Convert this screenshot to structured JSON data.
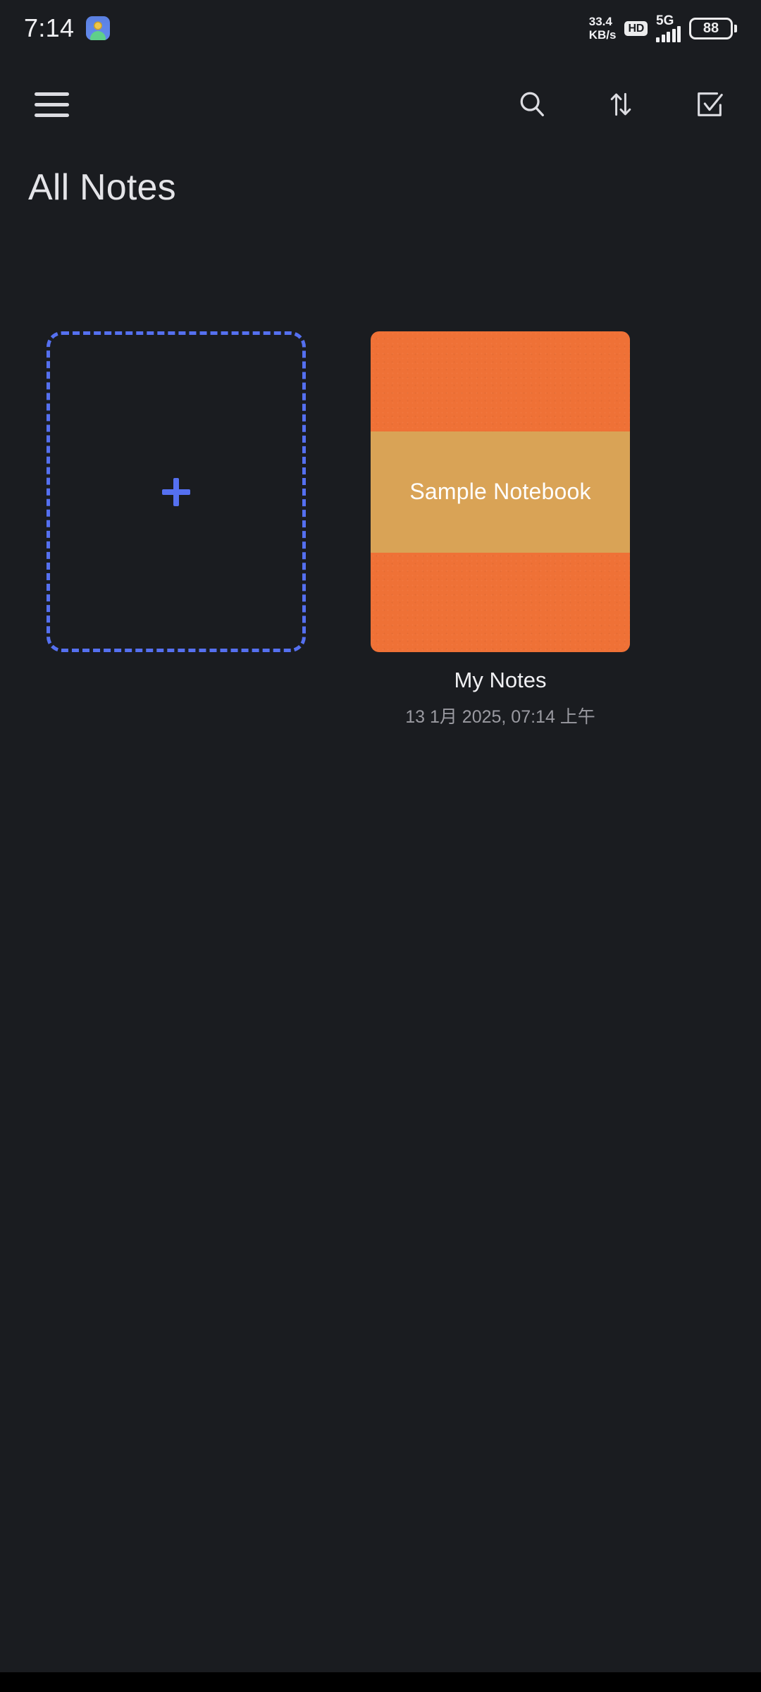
{
  "status_bar": {
    "clock": "7:14",
    "app_icon": "android-app-icon",
    "net_speed_value": "33.4",
    "net_speed_unit": "KB/s",
    "hd_badge": "HD",
    "network_generation": "5G",
    "signal_bars": 5,
    "battery_level": "88"
  },
  "toolbar": {
    "menu_icon": "hamburger-menu-icon",
    "search_icon": "search-icon",
    "sort_icon": "sort-arrows-icon",
    "select_icon": "checkbox-select-icon"
  },
  "header": {
    "title": "All Notes"
  },
  "grid": {
    "add_card": {
      "icon": "plus-icon",
      "accent_color": "#5570f0"
    },
    "notebooks": [
      {
        "cover_title": "Sample Notebook",
        "name": "My Notes",
        "date": "13 1月 2025, 07:14 上午",
        "cover_color": "#ef7136",
        "band_color": "#d9a356"
      }
    ]
  },
  "theme": {
    "background": "#1a1c20",
    "nav_bar": "#000000",
    "text_primary": "#e4e4e8",
    "text_secondary": "#9a9aa1",
    "icon_color": "#dcdce1"
  }
}
